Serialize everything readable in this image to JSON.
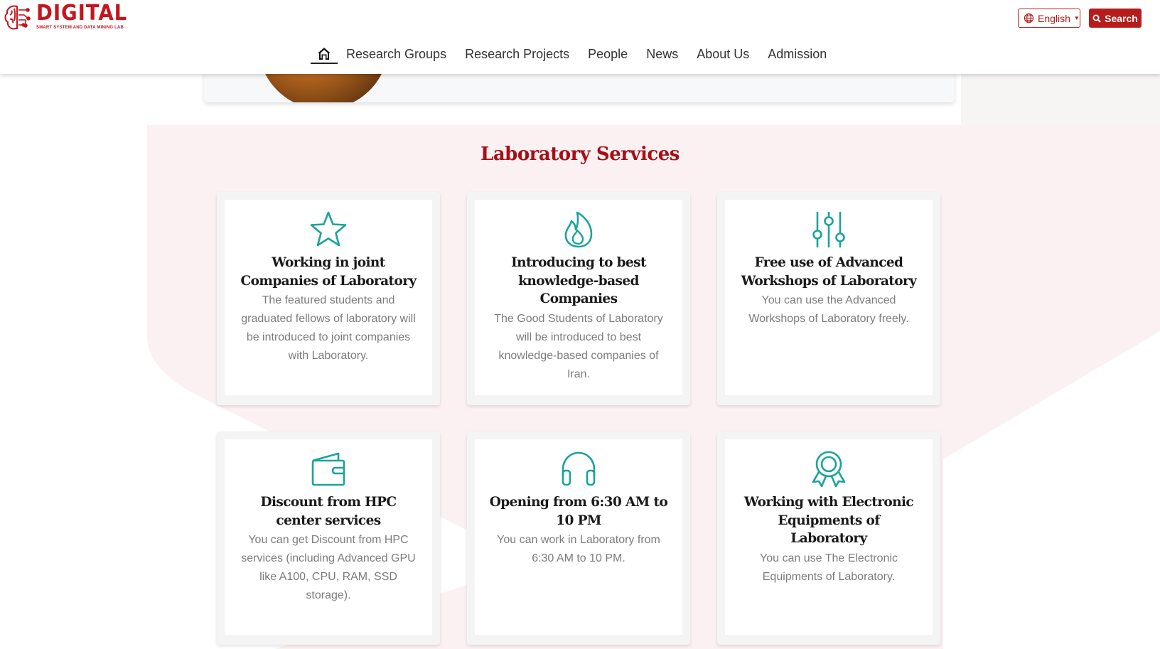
{
  "header": {
    "logo_title": "DIGITAL",
    "logo_subtitle": "SMART SYSTEM AND DATA MINING LAB",
    "language_label": "English",
    "search_label": "Search",
    "nav": [
      {
        "label": "Research Groups"
      },
      {
        "label": "Research Projects"
      },
      {
        "label": "People"
      },
      {
        "label": "News"
      },
      {
        "label": "About Us"
      },
      {
        "label": "Admission"
      }
    ]
  },
  "services": {
    "title": "Laboratory Services",
    "accent_color": "#1aa39a",
    "title_color": "#a50f17",
    "cards": [
      {
        "icon": "star-icon",
        "title": "Working in joint Companies of Laboratory",
        "description": "The featured students and graduated fellows of laboratory will be introduced to joint companies with Laboratory."
      },
      {
        "icon": "flame-icon",
        "title": "Introducing to best knowledge-based Companies",
        "description": "The Good Students of Laboratory will be introduced to best knowledge-based companies of Iran."
      },
      {
        "icon": "sliders-icon",
        "title": "Free use of Advanced Workshops of Laboratory",
        "description": "You can use the Advanced Workshops of Laboratory freely."
      },
      {
        "icon": "wallet-icon",
        "title": "Discount from HPC center services",
        "description": "You can get Discount from HPC services (including Advanced GPU like A100, CPU, RAM, SSD storage)."
      },
      {
        "icon": "headphones-icon",
        "title": "Opening from 6:30 AM to 10 PM",
        "description": "You can work in Laboratory from 6:30 AM to 10 PM."
      },
      {
        "icon": "award-icon",
        "title": "Working with Electronic Equipments of Laboratory",
        "description": "You can use The Electronic Equipments of Laboratory."
      }
    ]
  }
}
